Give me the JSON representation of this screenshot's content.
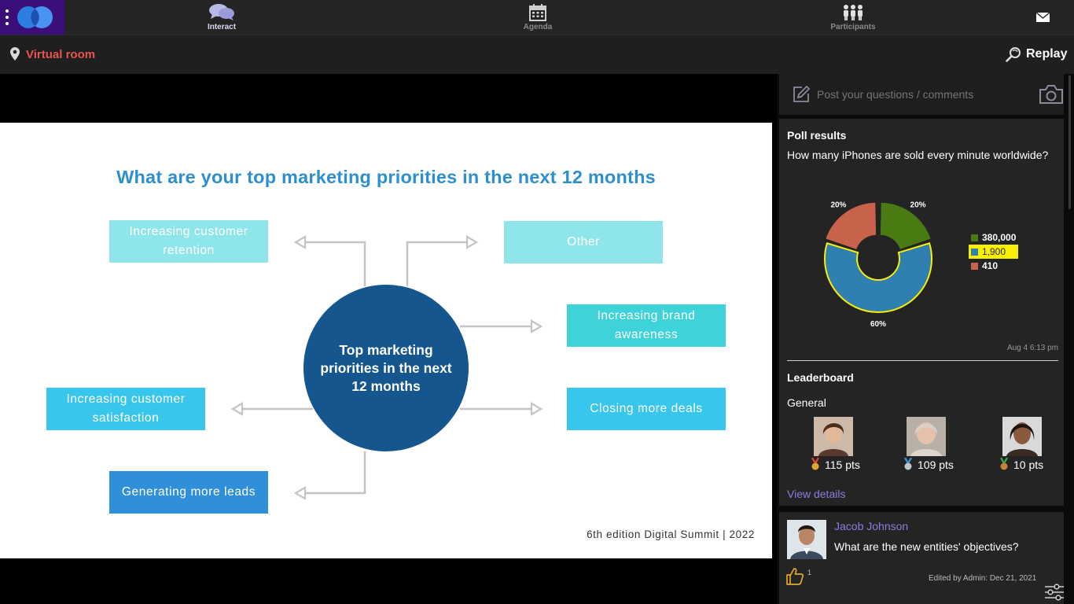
{
  "nav": {
    "tabs": [
      {
        "label": "Interact",
        "icon": "chat-bubbles-icon",
        "active": true
      },
      {
        "label": "Agenda",
        "icon": "calendar-icon",
        "active": false
      },
      {
        "label": "Participants",
        "icon": "participants-icon",
        "active": false
      }
    ],
    "accent": "#3a0f7a"
  },
  "subbar": {
    "room": "Virtual room",
    "replay": "Replay",
    "room_color": "#e8554d"
  },
  "slide": {
    "title": "What are your top marketing priorities in the next 12 months",
    "center": "Top marketing priorities in the next 12 months",
    "boxes": [
      {
        "label": "Increasing customer retention",
        "color": "#8ee6ea"
      },
      {
        "label": "Other",
        "color": "#8ee6ea"
      },
      {
        "label": "Increasing brand awareness",
        "color": "#3ed3d8"
      },
      {
        "label": "Increasing customer satisfaction",
        "color": "#39c6ec"
      },
      {
        "label": "Closing more deals",
        "color": "#39c6ec"
      },
      {
        "label": "Generating more leads",
        "color": "#2f8fd9"
      }
    ],
    "footer": "6th edition Digital Summit | 2022"
  },
  "comment_input": {
    "placeholder": "Post your questions / comments"
  },
  "poll": {
    "heading": "Poll results",
    "question": "How many iPhones are sold every minute worldwide?",
    "timestamp": "Aug 4 6:13 pm",
    "chart_data": {
      "type": "pie",
      "categories": [
        "380,000",
        "1,900",
        "410"
      ],
      "values": [
        20,
        60,
        20
      ],
      "value_labels": [
        "20%",
        "60%",
        "20%"
      ],
      "colors": [
        "#4a7a12",
        "#2f7fb0",
        "#c8634b"
      ],
      "highlighted": "1,900",
      "legend": "right"
    }
  },
  "leaderboard": {
    "heading": "Leaderboard",
    "category": "General",
    "entries": [
      {
        "points": "115 pts"
      },
      {
        "points": "109 pts"
      },
      {
        "points": "10 pts"
      }
    ],
    "view_details": "View details"
  },
  "comment": {
    "author": "Jacob Johnson",
    "text": "What are the new entities' objectives?",
    "likes": "1",
    "edited": "Edited by Admin: Dec 21, 2021"
  }
}
